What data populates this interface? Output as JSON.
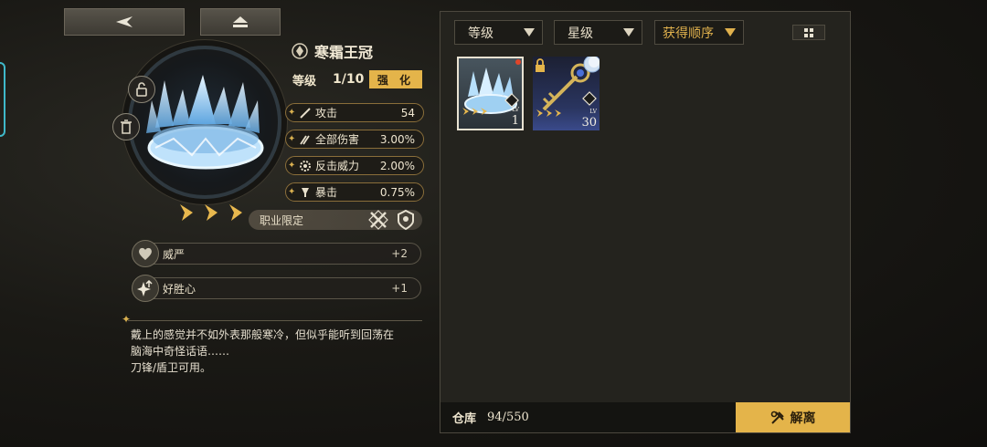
{
  "nav": {
    "back_icon": "back-arrow-icon",
    "home_icon": "eject-home-icon"
  },
  "item": {
    "name": "寒霜王冠",
    "name_icon": "crest-icon",
    "level_label": "等级",
    "level_value": "1/10",
    "enhance_label": "强 化",
    "lock_icon": "unlock-icon",
    "delete_icon": "trash-icon",
    "star_count": 3,
    "stats": [
      {
        "icon": "sword-icon",
        "label": "攻击",
        "value": "54"
      },
      {
        "icon": "slash-icon",
        "label": "全部伤害",
        "value": "3.00%"
      },
      {
        "icon": "gear-icon",
        "label": "反击威力",
        "value": "2.00%"
      },
      {
        "icon": "goblet-icon",
        "label": "暴击",
        "value": "0.75%"
      }
    ],
    "class_restriction_label": "职业限定",
    "class_icons": [
      "blade-class-icon",
      "shield-class-icon"
    ],
    "traits": [
      {
        "icon": "heart-icon",
        "label": "威严",
        "value": "+2"
      },
      {
        "icon": "sparkle-arrow-icon",
        "label": "好胜心",
        "value": "+1"
      }
    ],
    "description": "戴上的感觉并不如外表那般寒冷，但似乎能听到回荡在\n脑海中奇怪话语……\n刀锋/盾卫可用。"
  },
  "inventory": {
    "filters": [
      {
        "label": "等级",
        "active": false
      },
      {
        "label": "星级",
        "active": false
      },
      {
        "label": "获得顺序",
        "active": true
      }
    ],
    "view_toggle_icon": "grid-view-icon",
    "slots": [
      {
        "name": "寒霜王冠",
        "lv_label": "LV",
        "level": "1",
        "selected": true,
        "new": true,
        "locked": false
      },
      {
        "name": "钥匙",
        "lv_label": "LV",
        "level": "30",
        "selected": false,
        "new": false,
        "locked": true
      }
    ],
    "warehouse_label": "仓库",
    "warehouse_value": "94/550",
    "dismantle_label": "解离",
    "dismantle_icon": "dismantle-icon"
  },
  "colors": {
    "accent": "#e4b44a",
    "panel": "#24231e",
    "border_gold": "#8a6e3a"
  }
}
